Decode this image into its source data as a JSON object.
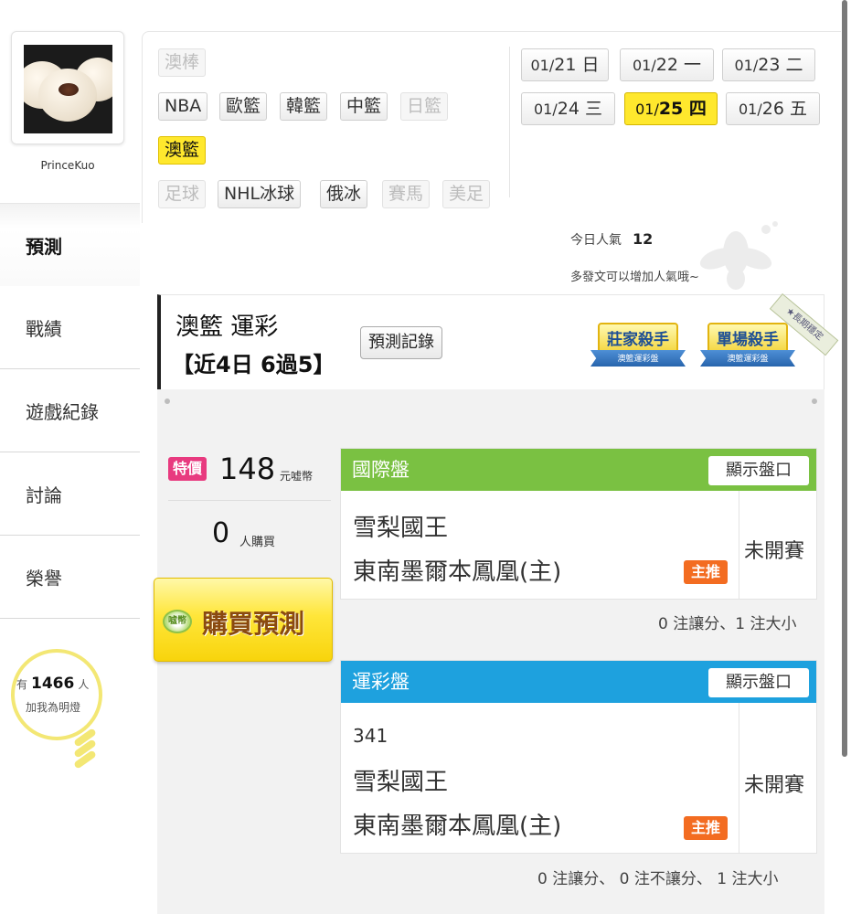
{
  "sidebar": {
    "username": "PrinceKuo",
    "items": [
      {
        "label": "預測"
      },
      {
        "label": "戰績"
      },
      {
        "label": "遊戲紀錄"
      },
      {
        "label": "討論"
      },
      {
        "label": "榮譽"
      }
    ],
    "bulb": {
      "prefix": "有",
      "count": "1466",
      "suffix": "人",
      "cta": "加我為明燈"
    }
  },
  "sports": {
    "row1": [
      "澳棒"
    ],
    "row2": [
      "NBA",
      "歐籃",
      "韓籃",
      "中籃",
      "日籃"
    ],
    "row3": [
      "澳籃"
    ],
    "row4": [
      "足球",
      "NHL冰球",
      "俄冰",
      "賽馬",
      "美足"
    ]
  },
  "dates": [
    {
      "date": "01/",
      "day": "21",
      "weekday": "日"
    },
    {
      "date": "01/",
      "day": "22",
      "weekday": "一"
    },
    {
      "date": "01/",
      "day": "23",
      "weekday": "二"
    },
    {
      "date": "01/",
      "day": "24",
      "weekday": "三"
    },
    {
      "date": "01/",
      "day": "25",
      "weekday": "四"
    },
    {
      "date": "01/",
      "day": "26",
      "weekday": "五"
    }
  ],
  "popularity": {
    "label": "今日人氣",
    "value": "12",
    "tip": "多發文可以增加人氣哦~"
  },
  "prediction": {
    "title": "澳籃 運彩",
    "record": "【近4日 6過5】",
    "record_button": "預測記錄",
    "badges": [
      {
        "title": "莊家殺手",
        "sub": "澳籃運彩盤"
      },
      {
        "title": "單場殺手",
        "sub": "澳籃運彩盤"
      }
    ],
    "ribbon": "★長期穩定"
  },
  "purchase": {
    "tag": "特價",
    "price": "148",
    "unit": "元嘘幣",
    "buyers": "0",
    "buyers_unit": "人購買",
    "buy_button": "購買預測",
    "coin_label": "嘘幣"
  },
  "markets": [
    {
      "name": "國際盤",
      "show_button": "顯示盤口",
      "color": "#7ac142",
      "game_no": "",
      "away": "雪梨國王",
      "home": "東南墨爾本鳳凰(主)",
      "tag": "主推",
      "status": "未開賽",
      "summary": "0 注讓分、1 注大小"
    },
    {
      "name": "運彩盤",
      "show_button": "顯示盤口",
      "color": "#1ea1de",
      "game_no": "341",
      "away": "雪梨國王",
      "home": "東南墨爾本鳳凰(主)",
      "tag": "主推",
      "status": "未開賽",
      "summary": "0 注讓分、 0 注不讓分、 1 注大小"
    }
  ]
}
